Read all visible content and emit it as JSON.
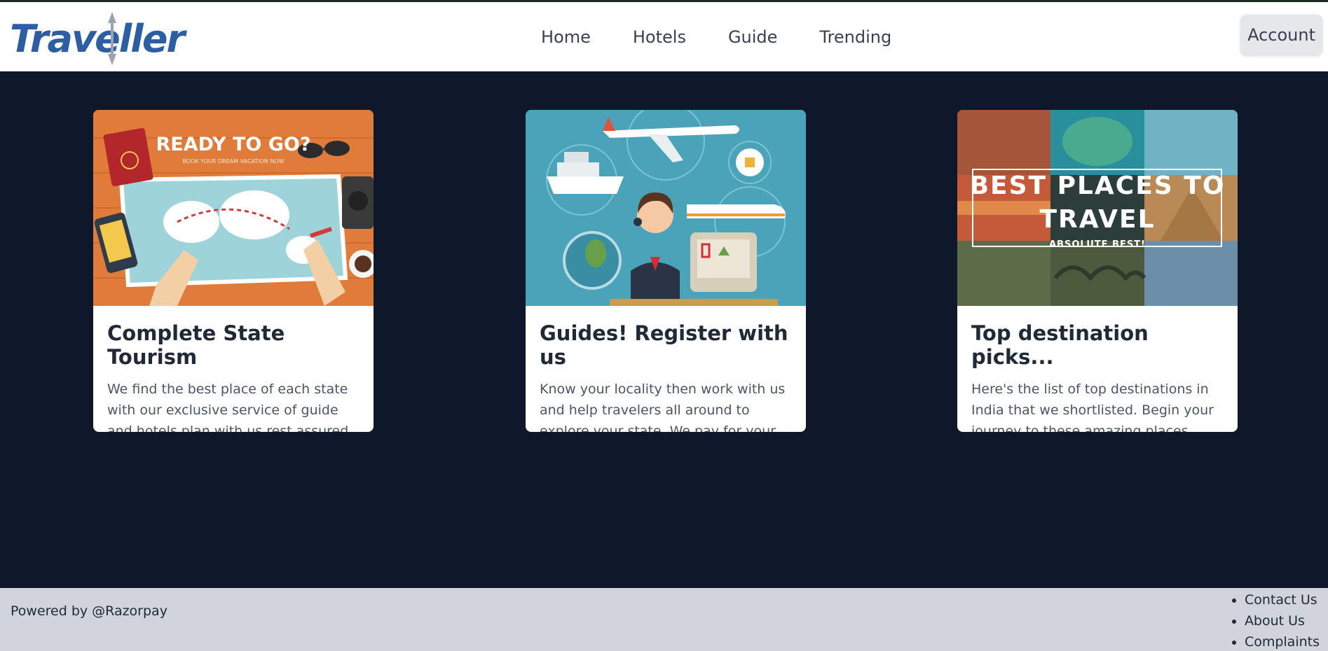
{
  "header": {
    "logo": "Traveller",
    "nav": [
      "Home",
      "Hotels",
      "Guide",
      "Trending"
    ],
    "account_label": "Account"
  },
  "cards": [
    {
      "title": "Complete State Tourism",
      "description": "We find the best place of each state with our exclusive service of guide and hotels plan with us rest assured.",
      "image_heading": "READY TO GO?",
      "image_sub": "BOOK YOUR DREAM VACATION NOW",
      "image_badge": "PASSPORT"
    },
    {
      "title": "Guides! Register with us",
      "description": "Know your locality then work with us and help travelers all around to explore your state. We pay for your services."
    },
    {
      "title": "Top destination picks...",
      "description": "Here's the list of top destinations in India that we shortlisted. Begin your journey to these amazing places.",
      "image_heading_1": "BEST PLACES TO",
      "image_heading_2": "TRAVEL",
      "image_sub": "ABSOLUTE BEST!"
    }
  ],
  "footer": {
    "powered": "Powered by @Razorpay",
    "links": [
      "Contact Us",
      "About Us",
      "Complaints"
    ]
  },
  "colors": {
    "page_bg": "#0f172a",
    "logo_blue": "#2b5ea3",
    "footer_bg": "#d1d5db"
  }
}
